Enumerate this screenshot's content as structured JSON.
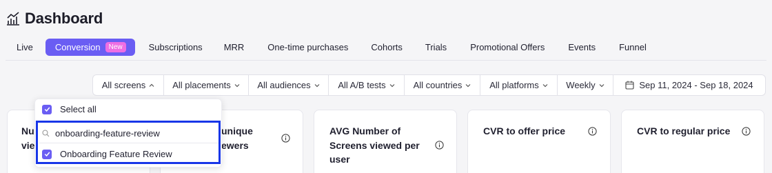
{
  "header": {
    "title": "Dashboard",
    "icon": "chart-line-icon"
  },
  "tabs": [
    {
      "label": "Live"
    },
    {
      "label": "Conversion",
      "badge": "New",
      "active": true
    },
    {
      "label": "Subscriptions"
    },
    {
      "label": "MRR"
    },
    {
      "label": "One-time purchases"
    },
    {
      "label": "Cohorts"
    },
    {
      "label": "Trials"
    },
    {
      "label": "Promotional Offers"
    },
    {
      "label": "Events"
    },
    {
      "label": "Funnel"
    }
  ],
  "filters": {
    "screens": "All screens",
    "placements": "All placements",
    "audiences": "All audiences",
    "ab_tests": "All A/B tests",
    "countries": "All countries",
    "platforms": "All platforms",
    "period": "Weekly",
    "date_range": "Sep 11, 2024 - Sep 18, 2024"
  },
  "dropdown": {
    "select_all": "Select all",
    "search_value": "onboarding-feature-review",
    "option": "Onboarding Feature Review"
  },
  "cards": {
    "c1": {
      "l1": "Nu",
      "l2": "vie"
    },
    "c2": {
      "l1": "unique",
      "l2": "ewers"
    },
    "c3": {
      "l1": "AVG Number of",
      "l2": "Screens viewed per",
      "l3": "user"
    },
    "c4": {
      "l1": "CVR to offer price"
    },
    "c5": {
      "l1": "CVR to regular price"
    }
  },
  "colors": {
    "accent": "#6a5df3",
    "badge": "#ee6ee3",
    "highlight": "#1836e8"
  }
}
